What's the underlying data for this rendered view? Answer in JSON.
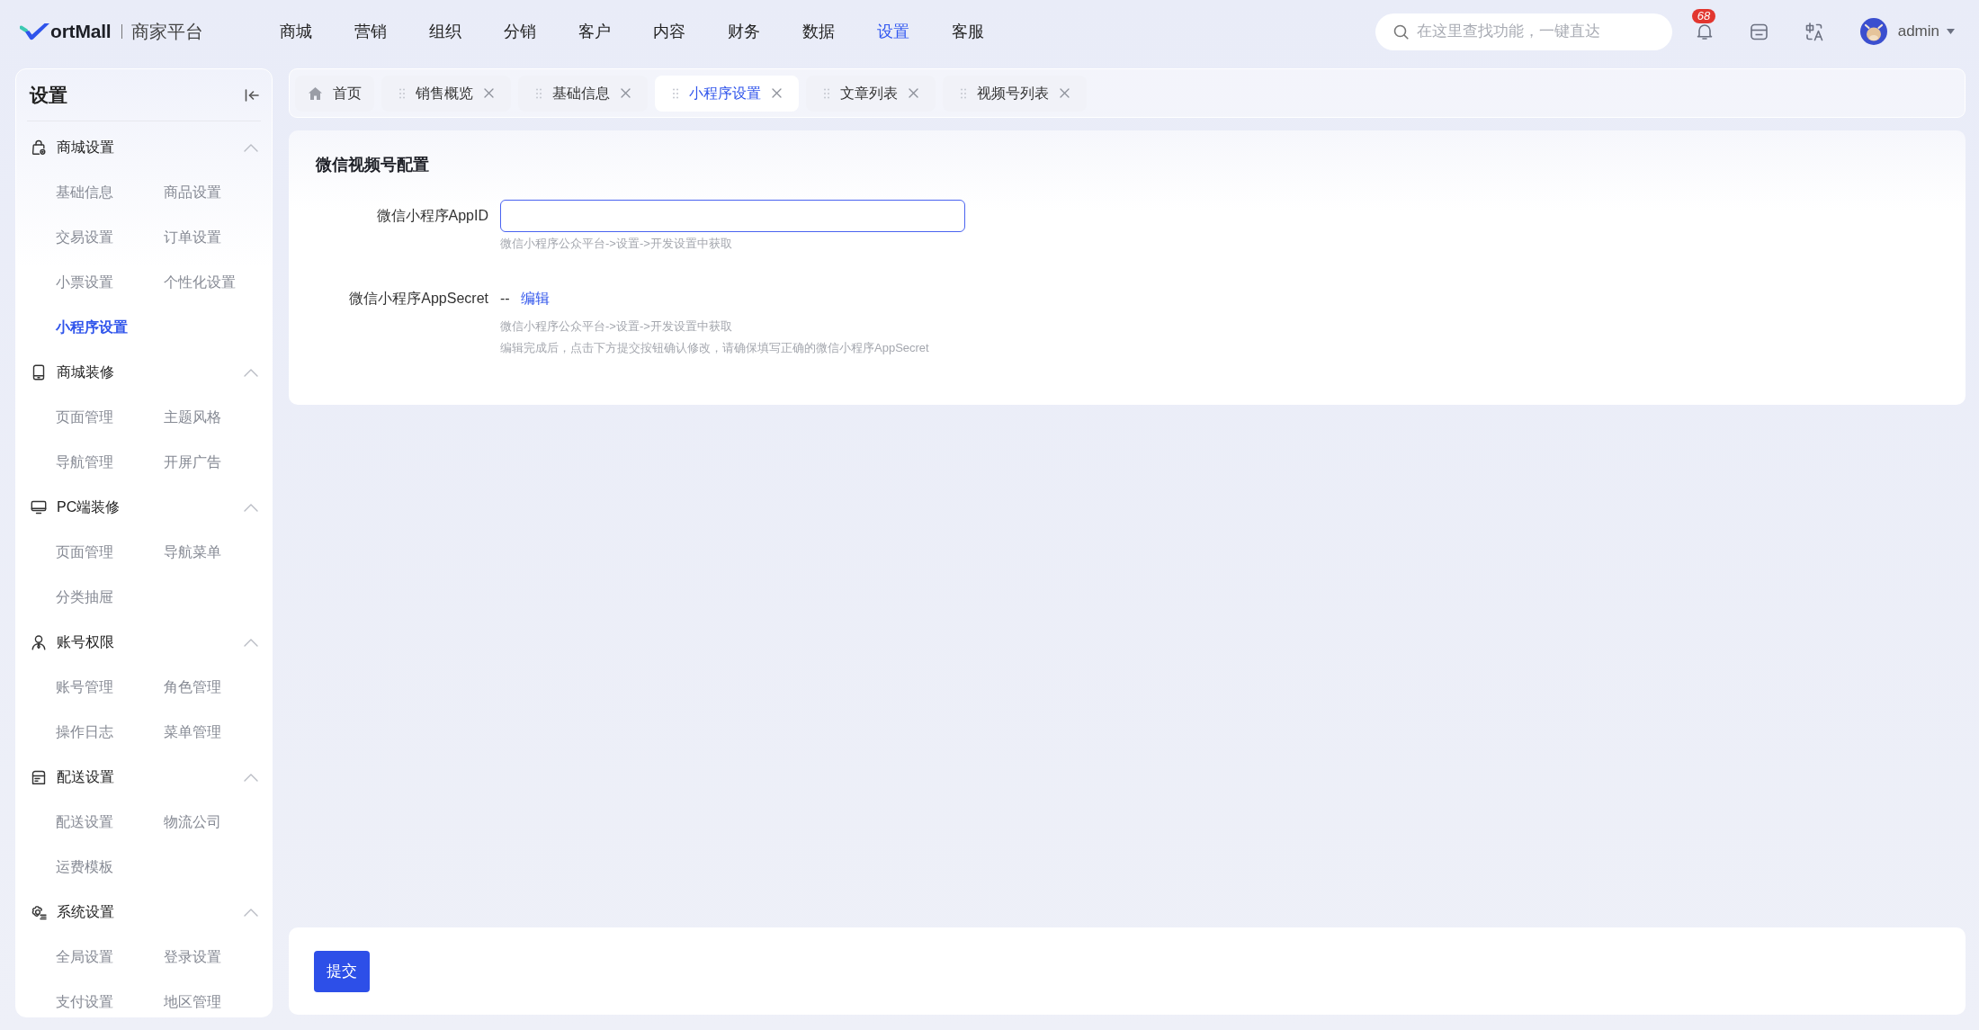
{
  "header": {
    "logo": {
      "name": "ortMall",
      "subtitle": "商家平台"
    },
    "nav": [
      {
        "label": "商城",
        "selected": false
      },
      {
        "label": "营销",
        "selected": false
      },
      {
        "label": "组织",
        "selected": false
      },
      {
        "label": "分销",
        "selected": false
      },
      {
        "label": "客户",
        "selected": false
      },
      {
        "label": "内容",
        "selected": false
      },
      {
        "label": "财务",
        "selected": false
      },
      {
        "label": "数据",
        "selected": false
      },
      {
        "label": "设置",
        "selected": true
      },
      {
        "label": "客服",
        "selected": false
      }
    ],
    "search": {
      "placeholder": "在这里查找功能，一键直达"
    },
    "notifications": {
      "badge": "68"
    },
    "user": {
      "name": "admin"
    }
  },
  "sidebar": {
    "title": "设置",
    "groups": [
      {
        "label": "商城设置",
        "expanded": true,
        "items": [
          {
            "label": "基础信息",
            "selected": false
          },
          {
            "label": "商品设置",
            "selected": false
          },
          {
            "label": "交易设置",
            "selected": false
          },
          {
            "label": "订单设置",
            "selected": false
          },
          {
            "label": "小票设置",
            "selected": false
          },
          {
            "label": "个性化设置",
            "selected": false
          },
          {
            "label": "小程序设置",
            "selected": true
          }
        ]
      },
      {
        "label": "商城装修",
        "expanded": true,
        "items": [
          {
            "label": "页面管理",
            "selected": false
          },
          {
            "label": "主题风格",
            "selected": false
          },
          {
            "label": "导航管理",
            "selected": false
          },
          {
            "label": "开屏广告",
            "selected": false
          }
        ]
      },
      {
        "label": "PC端装修",
        "expanded": true,
        "items": [
          {
            "label": "页面管理",
            "selected": false
          },
          {
            "label": "导航菜单",
            "selected": false
          },
          {
            "label": "分类抽屉",
            "selected": false
          }
        ]
      },
      {
        "label": "账号权限",
        "expanded": true,
        "items": [
          {
            "label": "账号管理",
            "selected": false
          },
          {
            "label": "角色管理",
            "selected": false
          },
          {
            "label": "操作日志",
            "selected": false
          },
          {
            "label": "菜单管理",
            "selected": false
          }
        ]
      },
      {
        "label": "配送设置",
        "expanded": true,
        "items": [
          {
            "label": "配送设置",
            "selected": false
          },
          {
            "label": "物流公司",
            "selected": false
          },
          {
            "label": "运费模板",
            "selected": false
          }
        ]
      },
      {
        "label": "系统设置",
        "expanded": true,
        "items": [
          {
            "label": "全局设置",
            "selected": false
          },
          {
            "label": "登录设置",
            "selected": false
          },
          {
            "label": "支付设置",
            "selected": false
          },
          {
            "label": "地区管理",
            "selected": false
          }
        ]
      }
    ]
  },
  "tabs": [
    {
      "label": "首页",
      "kind": "fixed",
      "selected": false
    },
    {
      "label": "销售概览",
      "kind": "closable",
      "selected": false
    },
    {
      "label": "基础信息",
      "kind": "closable",
      "selected": false
    },
    {
      "label": "小程序设置",
      "kind": "closable",
      "selected": true
    },
    {
      "label": "文章列表",
      "kind": "closable",
      "selected": false
    },
    {
      "label": "视频号列表",
      "kind": "closable",
      "selected": false
    }
  ],
  "config": {
    "title": "微信视频号配置",
    "fields": [
      {
        "kind": "input",
        "label": "微信小程序AppID",
        "focused": true,
        "hints": [
          "微信小程序公众平台->设置->开发设置中获取"
        ]
      },
      {
        "kind": "secret",
        "label": "微信小程序AppSecret",
        "value": "--",
        "action": "编辑",
        "hints": [
          "微信小程序公众平台->设置->开发设置中获取",
          "编辑完成后，点击下方提交按钮确认修改，请确保填写正确的微信小程序AppSecret"
        ]
      }
    ]
  },
  "footer": {
    "submit": "提交"
  }
}
